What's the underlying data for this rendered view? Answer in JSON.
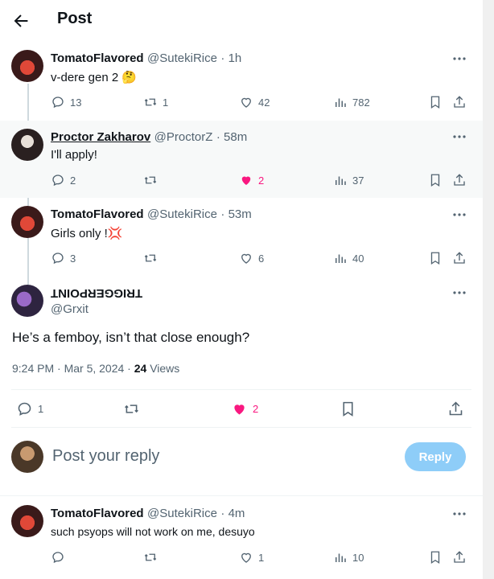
{
  "header": {
    "title": "Post"
  },
  "tweets": [
    {
      "name": "TomatoFlavored",
      "handle": "@SutekiRice",
      "time": "· 1h",
      "text": "v-dere gen 2 🤔",
      "replies": "13",
      "retweets": "1",
      "likes": "42",
      "views": "782"
    },
    {
      "name": "Proctor Zakharov",
      "handle": "@ProctorZ",
      "time": "· 58m",
      "text": "I'll apply!",
      "replies": "2",
      "retweets": "",
      "likes": "2",
      "views": "37"
    },
    {
      "name": "TomatoFlavored",
      "handle": "@SutekiRice",
      "time": "· 53m",
      "text": "Girls only !💢",
      "replies": "3",
      "retweets": "",
      "likes": "6",
      "views": "40"
    }
  ],
  "main": {
    "name": "TRIGGERPOINT",
    "handle": "@Grxit",
    "text": "He’s a femboy, isn’t that close enough?",
    "timestamp": "9:24 PM · Mar 5, 2024 ·",
    "views_count": "24",
    "views_label": "Views",
    "replies": "1",
    "likes": "2"
  },
  "compose": {
    "placeholder": "Post your reply",
    "button": "Reply"
  },
  "bottom": {
    "name": "TomatoFlavored",
    "handle": "@SutekiRice",
    "time": "· 4m",
    "text": "such psyops will not work on me, desuyo",
    "replies": "",
    "retweets": "",
    "likes": "1",
    "views": "10"
  },
  "colors": {
    "like": "#f91880",
    "accent": "#1d9bf0",
    "muted": "#536471"
  }
}
